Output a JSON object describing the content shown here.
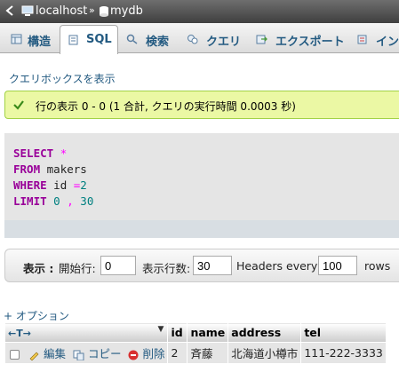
{
  "breadcrumb": {
    "server": "localhost",
    "separator": "»",
    "database": "mydb"
  },
  "tabs": [
    {
      "label": "構造",
      "icon": "structure-icon"
    },
    {
      "label": "SQL",
      "icon": "sql-icon",
      "active": true
    },
    {
      "label": "検索",
      "icon": "search-icon"
    },
    {
      "label": "クエリ",
      "icon": "query-icon"
    },
    {
      "label": "エクスポート",
      "icon": "export-icon"
    },
    {
      "label": "イン",
      "icon": "import-icon"
    }
  ],
  "show_query_link": "クエリボックスを表示",
  "success_message": "行の表示 0 - 0 (1 合計, クエリの実行時間 0.0003 秒)",
  "sql": {
    "select_kw": "SELECT",
    "select_star": "*",
    "from_kw": "FROM",
    "from_table": "makers",
    "where_kw": "WHERE",
    "where_col": "id",
    "where_op": "=",
    "where_val": "2",
    "limit_kw": "LIMIT",
    "limit_offset": "0",
    "limit_comma": ",",
    "limit_count": "30"
  },
  "navigation": {
    "display_label": "表示 :",
    "start_row_label": "開始行:",
    "start_row_value": "0",
    "rows_per_page_label": "表示行数:",
    "rows_per_page_value": "30",
    "headers_every_label": "Headers every",
    "headers_every_value": "100",
    "rows_label": "rows"
  },
  "options_link": "+ オプション",
  "table": {
    "arrows": "←T→",
    "sort_indicator": "▼",
    "columns": [
      "id",
      "name",
      "address",
      "tel"
    ],
    "row": {
      "edit": "編集",
      "copy": "コピー",
      "delete": "削除",
      "cells": [
        "2",
        "斉藤",
        "北海道小樽市",
        "111-222-3333"
      ]
    }
  },
  "colors": {
    "tab_text": "#235a81",
    "success_bg": "#ebf8a4",
    "sql_keyword": "#990099"
  }
}
